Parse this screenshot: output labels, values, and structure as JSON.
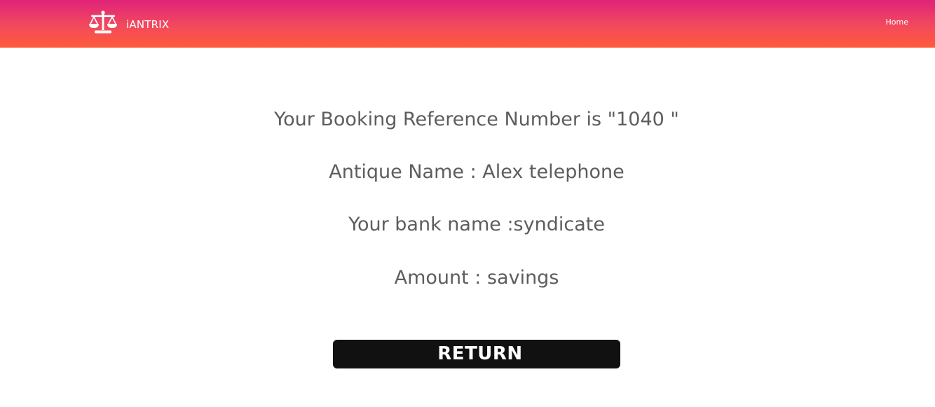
{
  "header": {
    "brand_name": "iANTRIX",
    "brand_icon": "scales-icon",
    "nav_home": "Home",
    "gradient_top": "#e0237a",
    "gradient_bottom": "#ff5a3c"
  },
  "main": {
    "booking_reference": "Your Booking Reference Number is \"1040 \"",
    "antique_name": "Antique Name : Alex telephone",
    "bank_name": "Your bank name :syndicate",
    "amount": "Amount : savings",
    "return_label": "RETURN",
    "text_color": "#5d5d5d",
    "button_color": "#111111"
  }
}
